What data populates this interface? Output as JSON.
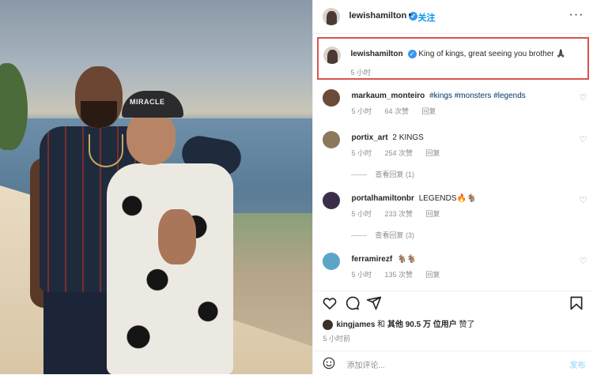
{
  "header": {
    "username": "lewishamilton",
    "follow_label": "关注",
    "dot": "•",
    "more": "···",
    "verified_mark": "✓"
  },
  "photo": {
    "cap_text": "MIRACLE"
  },
  "caption": {
    "username": "lewishamilton",
    "text": "King of kings, great seeing you brother",
    "emoji": "🙏🏿",
    "time": "5 小时"
  },
  "comments": [
    {
      "username": "markaum_monteiro",
      "text": "#kings #monsters #legends",
      "time": "5 小时",
      "likes": "64 次赞",
      "reply": "回复",
      "avatar_color": "#6b4a3a"
    },
    {
      "username": "portix_art",
      "text": "2 KINGS",
      "time": "5 小时",
      "likes": "254 次赞",
      "reply": "回复",
      "view_replies": "查看回复 (1)",
      "avatar_color": "#8a7a5a"
    },
    {
      "username": "portalhamiltonbr",
      "text": "LEGENDS🔥🐐",
      "time": "5 小时",
      "likes": "233 次赞",
      "reply": "回复",
      "view_replies": "查看回复 (3)",
      "avatar_color": "#3a2f4a"
    },
    {
      "username": "ferramirezf",
      "text": "🐐🐐",
      "time": "5 小时",
      "likes": "135 次赞",
      "reply": "回复",
      "avatar_color": "#5aa5c8"
    }
  ],
  "likes_line": {
    "user": "kingjames",
    "mid": " 和 ",
    "others": "其他 90.5 万 位用户",
    "end": " 赞了"
  },
  "post_time": "5 小时前",
  "add_comment": {
    "placeholder": "添加评论...",
    "post_label": "发布"
  },
  "icons": [
    "heart-icon",
    "comment-icon",
    "share-icon",
    "bookmark-icon",
    "emoji-icon",
    "more-icon"
  ]
}
